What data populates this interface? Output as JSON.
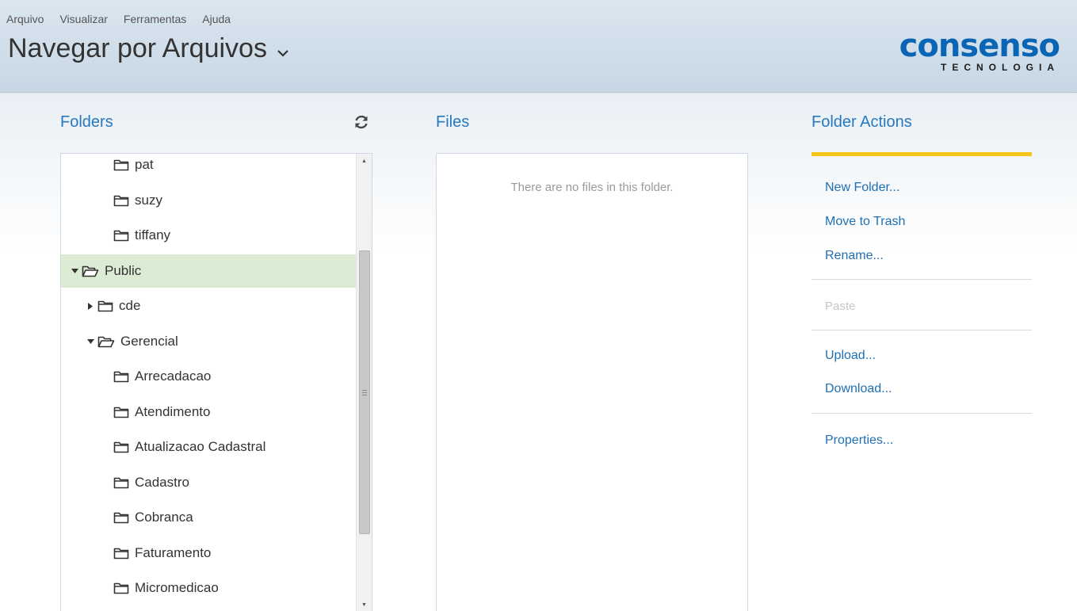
{
  "menu": [
    "Arquivo",
    "Visualizar",
    "Ferramentas",
    "Ajuda"
  ],
  "title": "Navegar por Arquivos",
  "logo": {
    "word": "consenso",
    "tagline": "TECNOLOGIA",
    "color": "#0a66b5"
  },
  "folders": {
    "heading": "Folders",
    "items": [
      {
        "label": "pat",
        "level": 2,
        "state": "leaf"
      },
      {
        "label": "suzy",
        "level": 2,
        "state": "leaf"
      },
      {
        "label": "tiffany",
        "level": 2,
        "state": "leaf"
      },
      {
        "label": "Public",
        "level": 0,
        "state": "expanded",
        "selected": true
      },
      {
        "label": "cde",
        "level": 1,
        "state": "collapsed"
      },
      {
        "label": "Gerencial",
        "level": 1,
        "state": "expanded"
      },
      {
        "label": "Arrecadacao",
        "level": 2,
        "state": "leaf"
      },
      {
        "label": "Atendimento",
        "level": 2,
        "state": "leaf"
      },
      {
        "label": "Atualizacao Cadastral",
        "level": 2,
        "state": "leaf"
      },
      {
        "label": "Cadastro",
        "level": 2,
        "state": "leaf"
      },
      {
        "label": "Cobranca",
        "level": 2,
        "state": "leaf"
      },
      {
        "label": "Faturamento",
        "level": 2,
        "state": "leaf"
      },
      {
        "label": "Micromedicao",
        "level": 2,
        "state": "leaf"
      }
    ]
  },
  "files": {
    "heading": "Files",
    "empty_message": "There are no files in this folder."
  },
  "folder_actions": {
    "heading": "Folder Actions",
    "accent_color": "#f6c61b",
    "new_folder": "New Folder...",
    "move_to_trash": "Move to Trash",
    "rename": "Rename...",
    "paste": "Paste",
    "upload": "Upload...",
    "download": "Download...",
    "properties": "Properties..."
  }
}
